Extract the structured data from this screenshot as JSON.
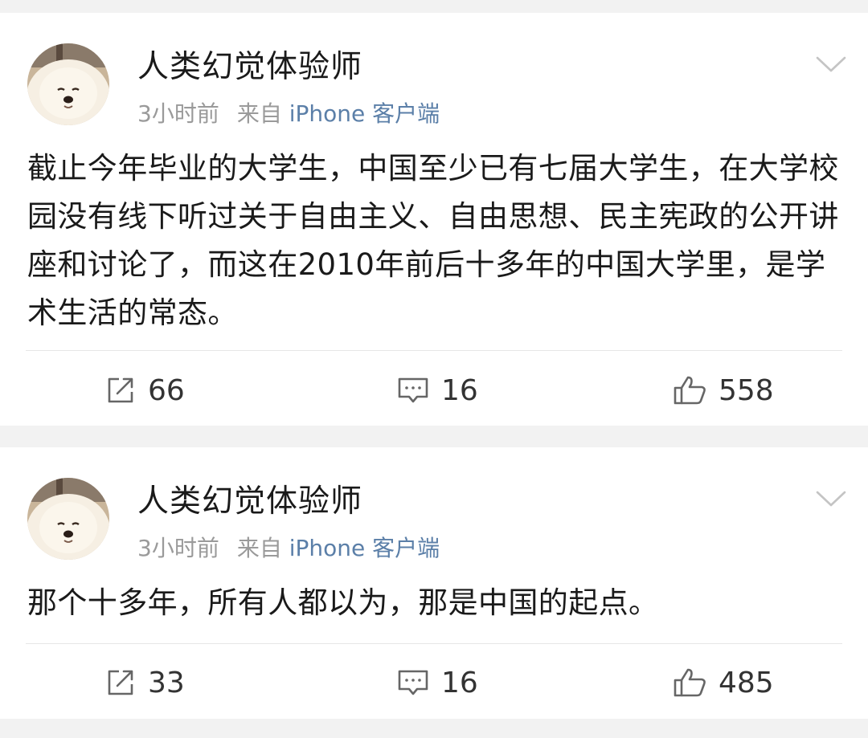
{
  "posts": [
    {
      "username": "人类幻觉体验师",
      "time": "3小时前",
      "source_prefix": "来自",
      "source": "iPhone 客户端",
      "text": "截止今年毕业的大学生，中国至少已有七届大学生，在大学校园没有线下听过关于自由主义、自由思想、民主宪政的公开讲座和讨论了，而这在2010年前后十多年的中国大学里，是学术生活的常态。",
      "reposts": "66",
      "comments": "16",
      "likes": "558"
    },
    {
      "username": "人类幻觉体验师",
      "time": "3小时前",
      "source_prefix": "来自",
      "source": "iPhone 客户端",
      "text": "那个十多年，所有人都以为，那是中国的起点。",
      "reposts": "33",
      "comments": "16",
      "likes": "485"
    }
  ],
  "icons": {
    "avatar": "pomeranian-avatar",
    "menu": "chevron-down-icon",
    "repost": "repost-icon",
    "comment": "comment-icon",
    "like": "thumbs-up-icon"
  },
  "colors": {
    "background": "#f2f2f2",
    "card": "#ffffff",
    "username": "#1a1a1a",
    "meta": "#9a9a9a",
    "source_link": "#5b7fa8",
    "text": "#1a1a1a"
  }
}
